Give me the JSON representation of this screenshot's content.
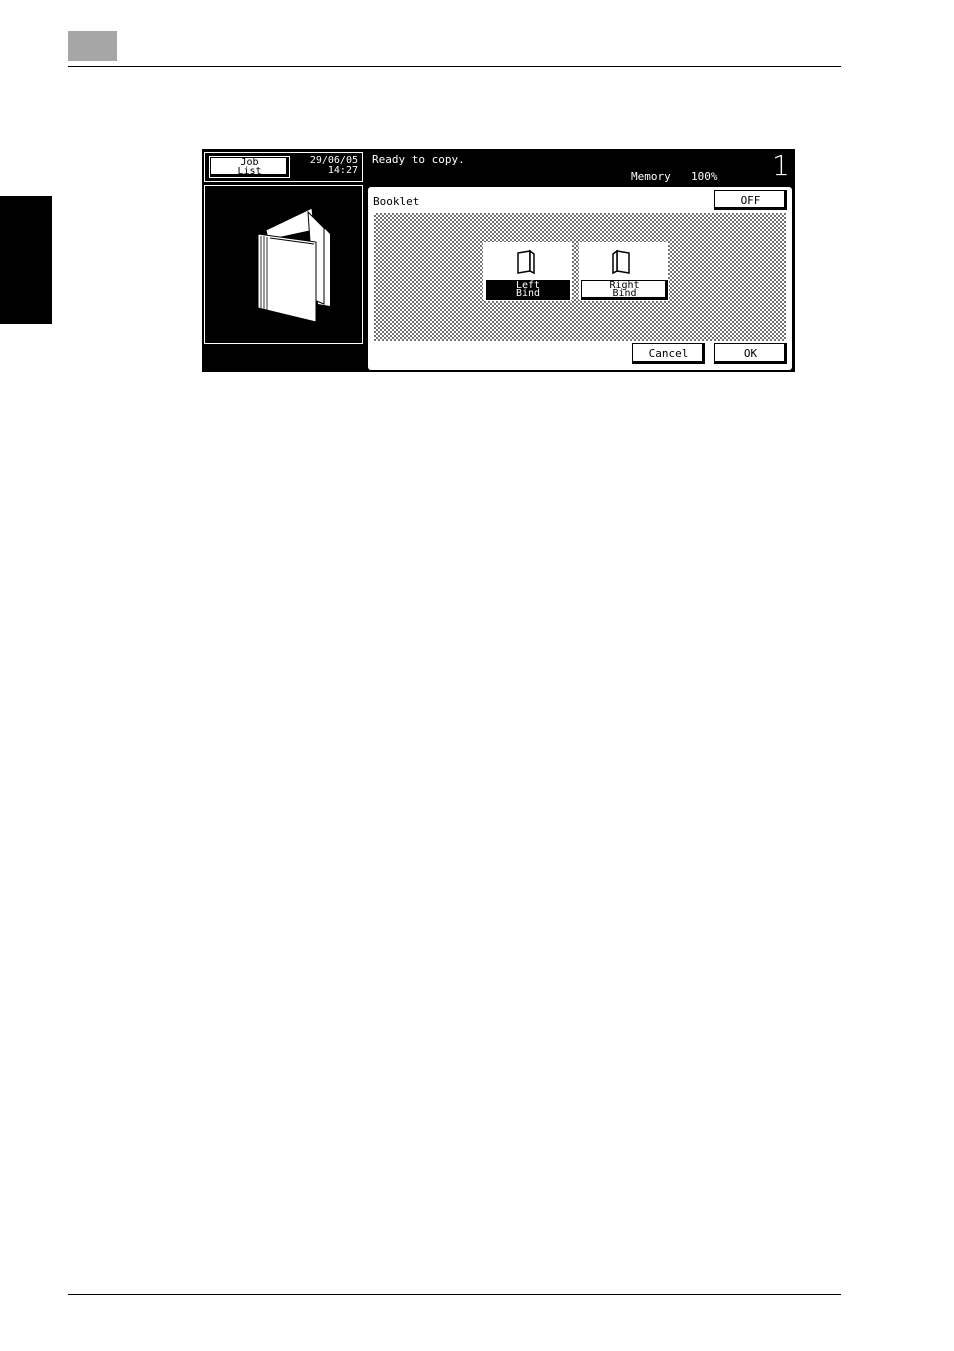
{
  "panel": {
    "job_list_label_line1": "Job",
    "job_list_label_line2": "List",
    "date": "29/06/05",
    "time": "14:27",
    "status": "Ready to copy.",
    "memory_label": "Memory",
    "memory_value": "100%",
    "copy_count": "1"
  },
  "dialog": {
    "title": "Booklet",
    "off_label": "OFF",
    "options": [
      {
        "line1": "Left",
        "line2": "Bind",
        "selected": true,
        "icon": "left-bind-icon"
      },
      {
        "line1": "Right",
        "line2": "Bind",
        "selected": false,
        "icon": "right-bind-icon"
      }
    ],
    "cancel_label": "Cancel",
    "ok_label": "OK"
  },
  "colors": {
    "panel_bg": "#000000",
    "chapter_box": "#a6a6a6"
  }
}
